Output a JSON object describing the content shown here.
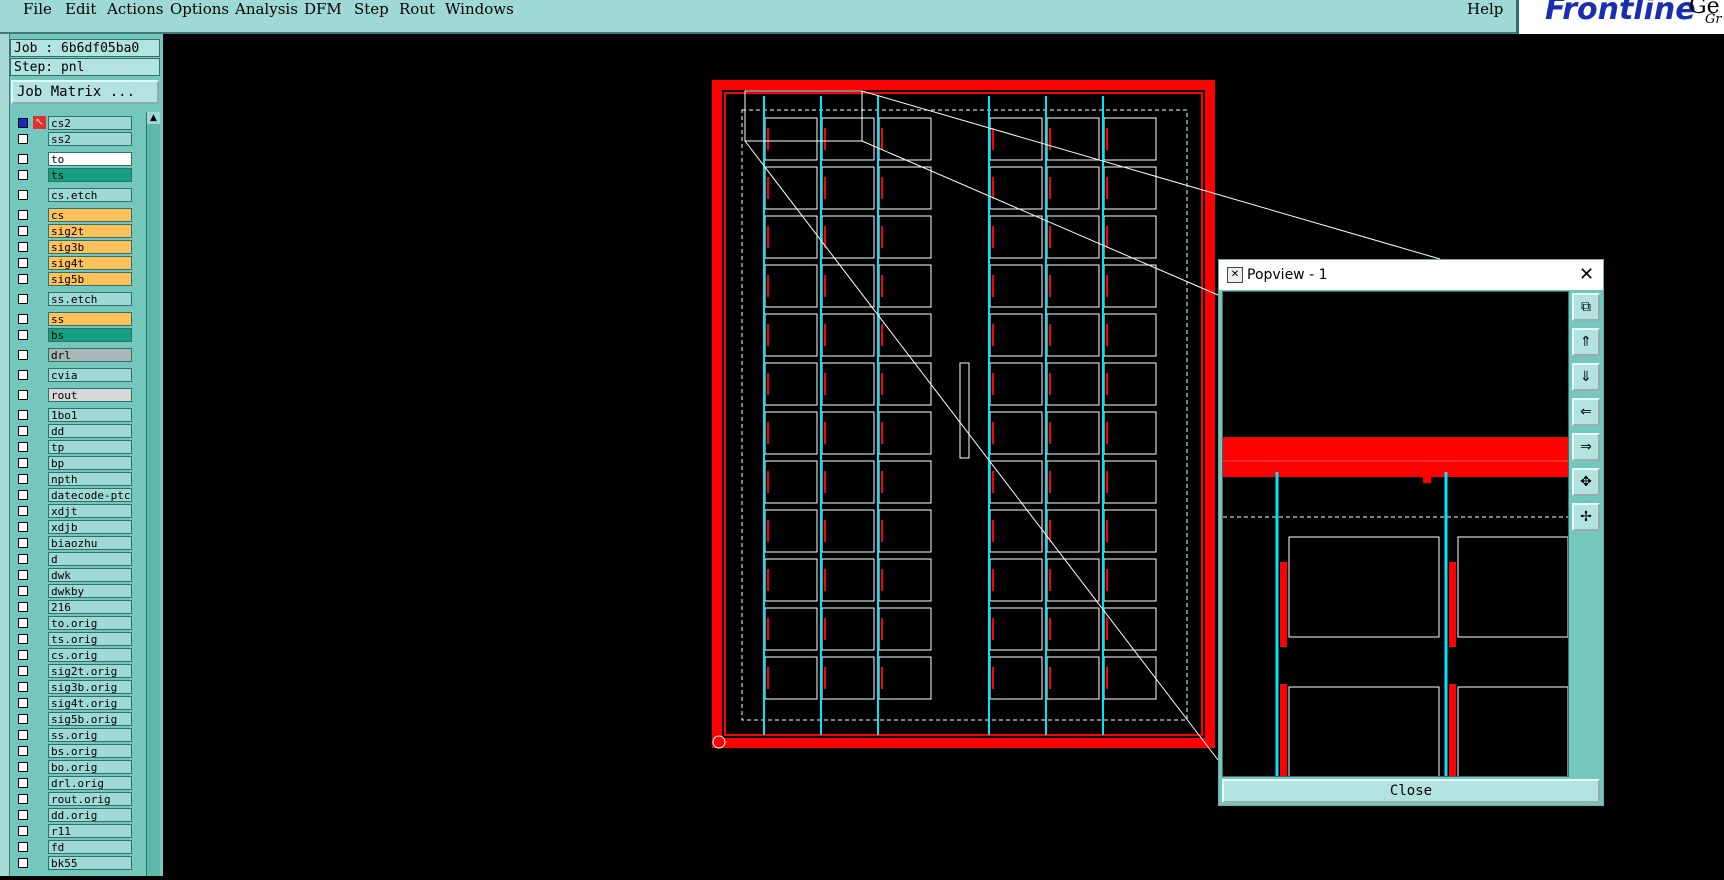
{
  "menubar": {
    "items": [
      "File",
      "Edit",
      "Actions",
      "Options",
      "Analysis",
      "DFM",
      "Step",
      "Rout",
      "Windows"
    ],
    "help": "Help"
  },
  "logo": {
    "text": "Frontline",
    "sub1": "Ge",
    "sub2": "Gr"
  },
  "job": {
    "label": "Job : 6b6df05ba0",
    "step": "Step: pnl",
    "matrix_button": "Job Matrix ..."
  },
  "layers": [
    {
      "name": "cs2",
      "color": "#9fd9d6",
      "active": true
    },
    {
      "name": "ss2",
      "color": "#9fd9d6"
    },
    {
      "name": "to",
      "color": "#ffffff"
    },
    {
      "name": "ts",
      "color": "#16a083"
    },
    {
      "name": "cs.etch",
      "color": "#9fd9d6"
    },
    {
      "name": "cs",
      "color": "#ffc25a"
    },
    {
      "name": "sig2t",
      "color": "#ffc25a"
    },
    {
      "name": "sig3b",
      "color": "#ffc25a"
    },
    {
      "name": "sig4t",
      "color": "#ffc25a"
    },
    {
      "name": "sig5b",
      "color": "#ffc25a"
    },
    {
      "name": "ss.etch",
      "color": "#9fd9d6"
    },
    {
      "name": "ss",
      "color": "#ffc25a"
    },
    {
      "name": "bs",
      "color": "#16a083"
    },
    {
      "name": "drl",
      "color": "#a8b8b8"
    },
    {
      "name": "cvia",
      "color": "#9fd9d6"
    },
    {
      "name": "rout",
      "color": "#d8d8d8"
    },
    {
      "name": "1bo1",
      "color": "#9fd9d6"
    },
    {
      "name": "dd",
      "color": "#9fd9d6"
    },
    {
      "name": "tp",
      "color": "#9fd9d6"
    },
    {
      "name": "bp",
      "color": "#9fd9d6"
    },
    {
      "name": "npth",
      "color": "#9fd9d6"
    },
    {
      "name": "datecode-ptc",
      "color": "#9fd9d6"
    },
    {
      "name": "xdjt",
      "color": "#9fd9d6"
    },
    {
      "name": "xdjb",
      "color": "#9fd9d6"
    },
    {
      "name": "biaozhu",
      "color": "#9fd9d6"
    },
    {
      "name": "d",
      "color": "#9fd9d6"
    },
    {
      "name": "dwk",
      "color": "#9fd9d6"
    },
    {
      "name": "dwkby",
      "color": "#9fd9d6"
    },
    {
      "name": "216",
      "color": "#9fd9d6"
    },
    {
      "name": "to.orig",
      "color": "#9fd9d6"
    },
    {
      "name": "ts.orig",
      "color": "#9fd9d6"
    },
    {
      "name": "cs.orig",
      "color": "#9fd9d6"
    },
    {
      "name": "sig2t.orig",
      "color": "#9fd9d6"
    },
    {
      "name": "sig3b.orig",
      "color": "#9fd9d6"
    },
    {
      "name": "sig4t.orig",
      "color": "#9fd9d6"
    },
    {
      "name": "sig5b.orig",
      "color": "#9fd9d6"
    },
    {
      "name": "ss.orig",
      "color": "#9fd9d6"
    },
    {
      "name": "bs.orig",
      "color": "#9fd9d6"
    },
    {
      "name": "bo.orig",
      "color": "#9fd9d6"
    },
    {
      "name": "drl.orig",
      "color": "#9fd9d6"
    },
    {
      "name": "rout.orig",
      "color": "#9fd9d6"
    },
    {
      "name": "dd.orig",
      "color": "#9fd9d6"
    },
    {
      "name": "r11",
      "color": "#9fd9d6"
    },
    {
      "name": "fd",
      "color": "#9fd9d6"
    },
    {
      "name": "bk55",
      "color": "#9fd9d6"
    }
  ],
  "popview": {
    "title": "Popview - 1",
    "close_label": "Close"
  },
  "colors": {
    "panel_border": "#ff0000",
    "route": "#00e5ff",
    "outline": "#ffffff"
  }
}
